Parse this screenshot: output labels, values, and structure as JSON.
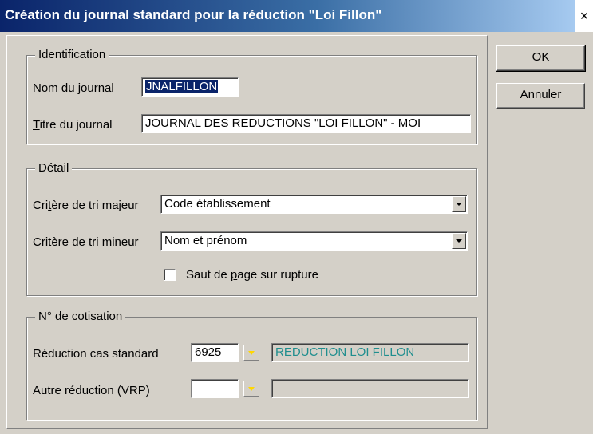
{
  "window": {
    "title": "Création du journal standard pour la réduction \"Loi Fillon\"",
    "close_glyph": "×"
  },
  "buttons": {
    "ok": "OK",
    "cancel": "Annuler"
  },
  "identification": {
    "legend": "Identification",
    "nom_label_accel": "N",
    "nom_label_rest": "om du journal",
    "nom_value": "JNALFILLON",
    "titre_label_accel": "T",
    "titre_label_rest": "itre du journal",
    "titre_value": "JOURNAL DES REDUCTIONS \"LOI FILLON\" - MOI"
  },
  "detail": {
    "legend": "Détail",
    "majeur_label_pre": "Cri",
    "majeur_label_accel": "t",
    "majeur_label_post": "ère de tri majeur",
    "majeur_value": "Code établissement",
    "mineur_label_pre": "Cri",
    "mineur_label_accel": "t",
    "mineur_label_post": "ère de tri mineur",
    "mineur_value": "Nom et prénom",
    "saut_label_pre": "Saut de ",
    "saut_label_accel": "p",
    "saut_label_post": "age sur rupture",
    "saut_checked": false
  },
  "cotisation": {
    "legend": "N° de cotisation",
    "standard_label": "Réduction cas standard",
    "standard_code": "6925",
    "standard_desc": "REDUCTION LOI FILLON",
    "autre_label": "Autre réduction (VRP)",
    "autre_code": "",
    "autre_desc": ""
  },
  "colors": {
    "titlebar_start": "#0a246a",
    "titlebar_end": "#a6caf0",
    "dialog_bg": "#d4d0c8",
    "description_text": "#1f8e8e",
    "dropdown_arrow_accent": "#ffd700"
  }
}
